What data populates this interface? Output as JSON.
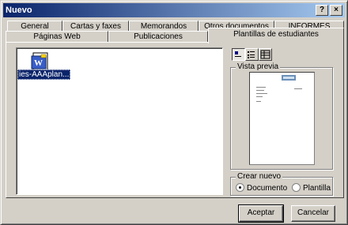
{
  "window": {
    "title": "Nuevo",
    "help_label": "?",
    "close_label": "×"
  },
  "tabs_back": [
    "General",
    "Cartas y faxes",
    "Memorandos",
    "Otros documentos",
    "INFORMES"
  ],
  "tabs_front": [
    "Páginas Web",
    "Publicaciones",
    "Plantillas de estudiantes"
  ],
  "active_tab": "Plantillas de estudiantes",
  "files": [
    {
      "label": "ies-AAAplan...",
      "icon": "word-template-icon",
      "selected": true
    }
  ],
  "view_buttons": [
    "large-icons-icon",
    "list-icon",
    "details-icon"
  ],
  "preview": {
    "label": "Vista previa"
  },
  "create_new": {
    "label": "Crear nuevo",
    "document_label": "Documento",
    "template_label": "Plantilla",
    "selected": "Documento"
  },
  "buttons": {
    "accept": "Aceptar",
    "cancel": "Cancelar"
  },
  "colors": {
    "titlebar_start": "#0a246a",
    "titlebar_end": "#a6caf0",
    "face": "#d4d0c8",
    "selection": "#0a246a"
  }
}
